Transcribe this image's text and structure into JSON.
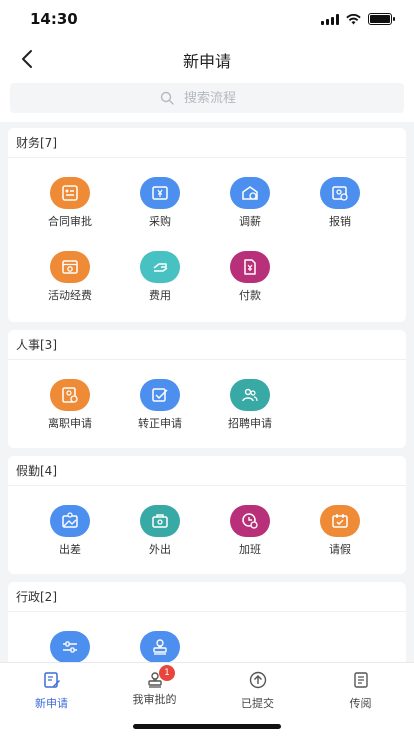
{
  "status": {
    "time": "14:30"
  },
  "nav": {
    "title": "新申请"
  },
  "search": {
    "placeholder": "搜索流程"
  },
  "sections": [
    {
      "title": "财务[7]",
      "items": [
        {
          "label": "合同审批",
          "color": "#ef8a36",
          "icon": "contract-icon"
        },
        {
          "label": "采购",
          "color": "#4d8fef",
          "icon": "purchase-icon"
        },
        {
          "label": "调薪",
          "color": "#4d8fef",
          "icon": "salary-adjust-icon"
        },
        {
          "label": "报销",
          "color": "#4d8fef",
          "icon": "reimburse-icon"
        },
        {
          "label": "活动经费",
          "color": "#ef8a36",
          "icon": "activity-fund-icon"
        },
        {
          "label": "费用",
          "color": "#48c1c3",
          "icon": "expense-icon"
        },
        {
          "label": "付款",
          "color": "#b8307a",
          "icon": "payment-icon"
        }
      ]
    },
    {
      "title": "人事[3]",
      "items": [
        {
          "label": "离职申请",
          "color": "#ef8a36",
          "icon": "resignation-icon"
        },
        {
          "label": "转正申请",
          "color": "#4d8fef",
          "icon": "regularization-icon"
        },
        {
          "label": "招聘申请",
          "color": "#39a9a5",
          "icon": "recruit-icon"
        }
      ]
    },
    {
      "title": "假勤[4]",
      "items": [
        {
          "label": "出差",
          "color": "#4d8fef",
          "icon": "business-trip-icon"
        },
        {
          "label": "外出",
          "color": "#39a9a5",
          "icon": "go-out-icon"
        },
        {
          "label": "加班",
          "color": "#b8307a",
          "icon": "overtime-icon"
        },
        {
          "label": "请假",
          "color": "#ef8a36",
          "icon": "leave-icon"
        }
      ]
    },
    {
      "title": "行政[2]",
      "items": [
        {
          "label": "",
          "color": "#4d8fef",
          "icon": "settings-slider-icon"
        },
        {
          "label": "",
          "color": "#4d8fef",
          "icon": "stamp-icon"
        }
      ]
    }
  ],
  "tabs": [
    {
      "label": "新申请",
      "icon": "edit-doc-icon",
      "active": true
    },
    {
      "label": "我审批的",
      "icon": "approve-stamp-icon",
      "badge": "1"
    },
    {
      "label": "已提交",
      "icon": "upload-circle-icon"
    },
    {
      "label": "传阅",
      "icon": "circulate-doc-icon"
    }
  ]
}
